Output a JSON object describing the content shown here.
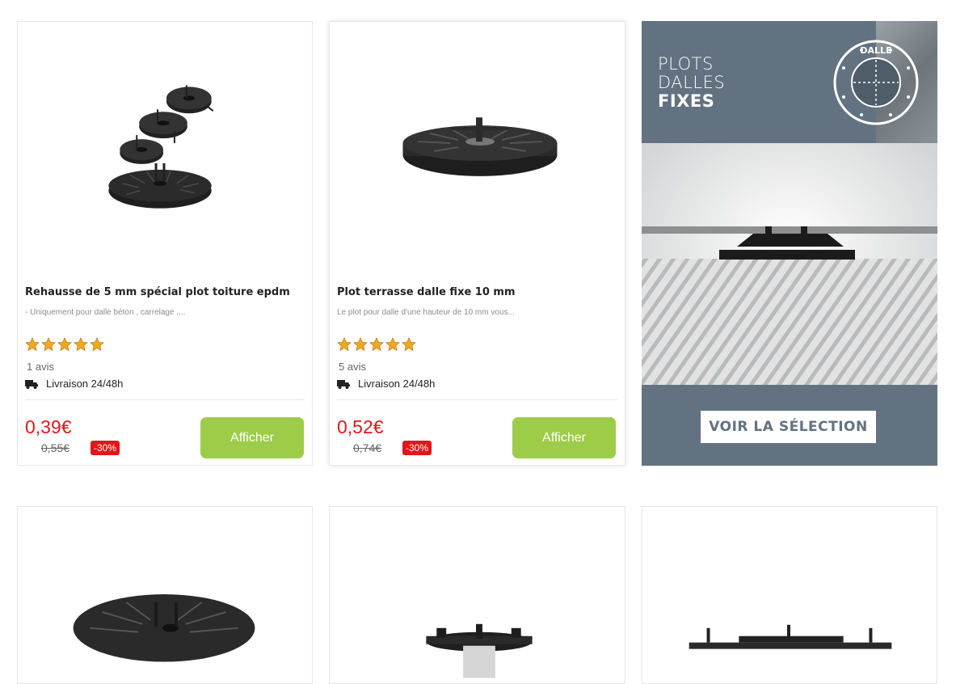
{
  "products": [
    {
      "title": "Rehausse de 5 mm spécial plot toiture epdm",
      "description": "- Uniquement pour dalle béton , carrelage ,...",
      "rating_stars": 5,
      "reviews": "1 avis",
      "delivery": "Livraison 24/48h",
      "price": "0,39€",
      "old_price": "0,55€",
      "discount": "-30%",
      "button": "Afficher"
    },
    {
      "title": "Plot terrasse dalle fixe 10 mm",
      "description": "Le plot pour dalle d'une hauteur de 10 mm vous...",
      "rating_stars": 5,
      "reviews": "5 avis",
      "delivery": "Livraison 24/48h",
      "price": "0,52€",
      "old_price": "0,74€",
      "discount": "-30%",
      "button": "Afficher"
    }
  ],
  "banner": {
    "line1": "PLOTS",
    "line2": "DALLES",
    "line3": "FIXES",
    "seal_text": "DALLE",
    "cta": "VOIR LA SÉLECTION"
  },
  "icons": {
    "star": "star-icon",
    "truck": "truck-icon"
  },
  "colors": {
    "price": "#e3151b",
    "button": "#9dcc48",
    "banner": "#627281",
    "star": "#f2a81d"
  }
}
